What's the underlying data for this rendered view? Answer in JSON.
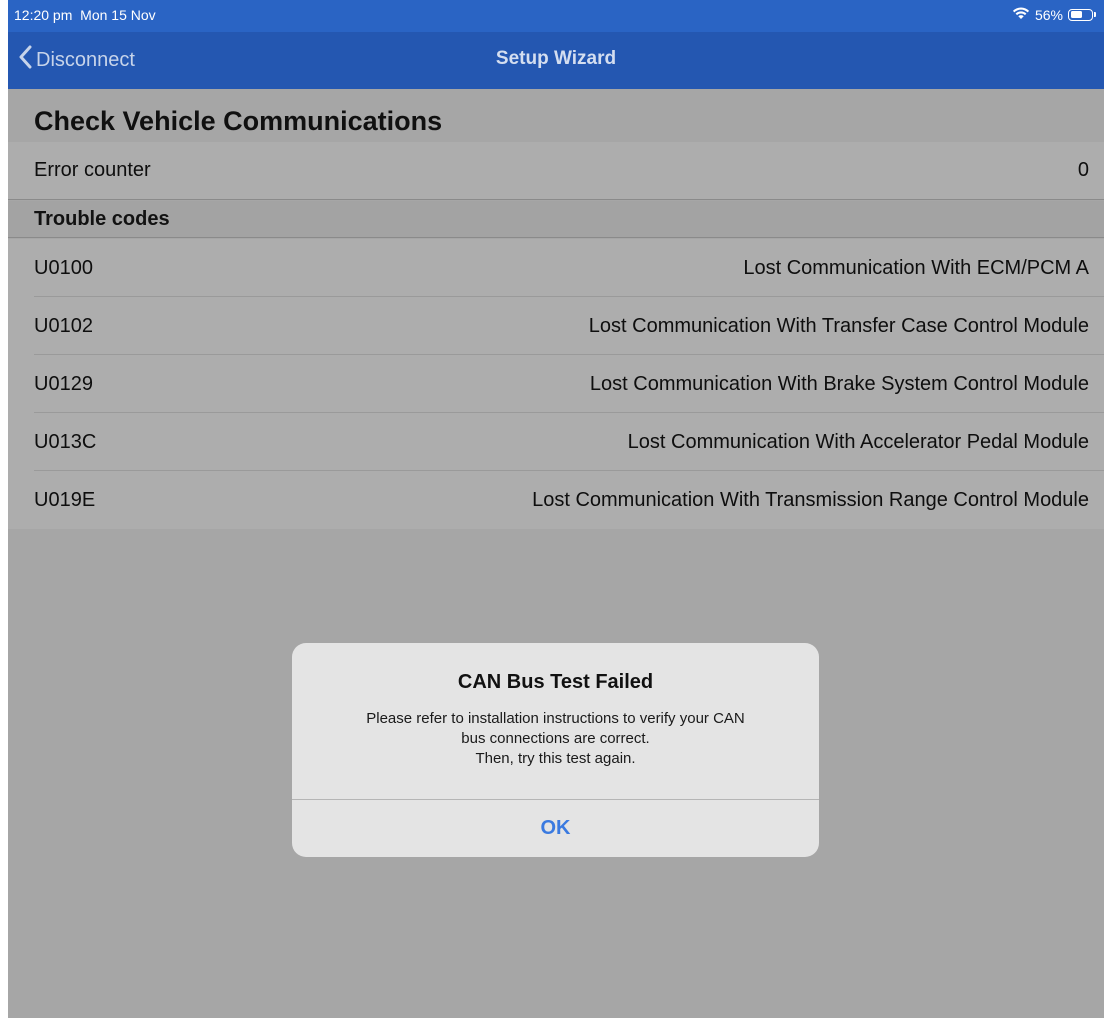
{
  "status_bar": {
    "time": "12:20 pm",
    "date": "Mon 15 Nov",
    "battery_percent": "56%",
    "battery_level": 0.56,
    "color": "#2a64c4"
  },
  "nav": {
    "back_label": "Disconnect",
    "title": "Setup Wizard",
    "color": "#2457b1"
  },
  "content": {
    "title": "Check Vehicle Communications",
    "error_counter": {
      "label": "Error counter",
      "value": "0"
    },
    "trouble_codes_header": "Trouble codes",
    "trouble_codes": [
      {
        "code": "U0100",
        "description": "Lost Communication With ECM/PCM A"
      },
      {
        "code": "U0102",
        "description": "Lost Communication With Transfer Case Control Module"
      },
      {
        "code": "U0129",
        "description": "Lost Communication With Brake System Control Module"
      },
      {
        "code": "U013C",
        "description": "Lost Communication With Accelerator Pedal Module"
      },
      {
        "code": "U019E",
        "description": "Lost Communication With Transmission Range Control Module"
      }
    ]
  },
  "alert": {
    "title": "CAN Bus Test Failed",
    "message_lines": [
      "Please refer to installation instructions to verify your CAN",
      "bus connections are correct.",
      "Then, try this test again."
    ],
    "ok_label": "OK",
    "button_color": "#3a7ae0"
  }
}
